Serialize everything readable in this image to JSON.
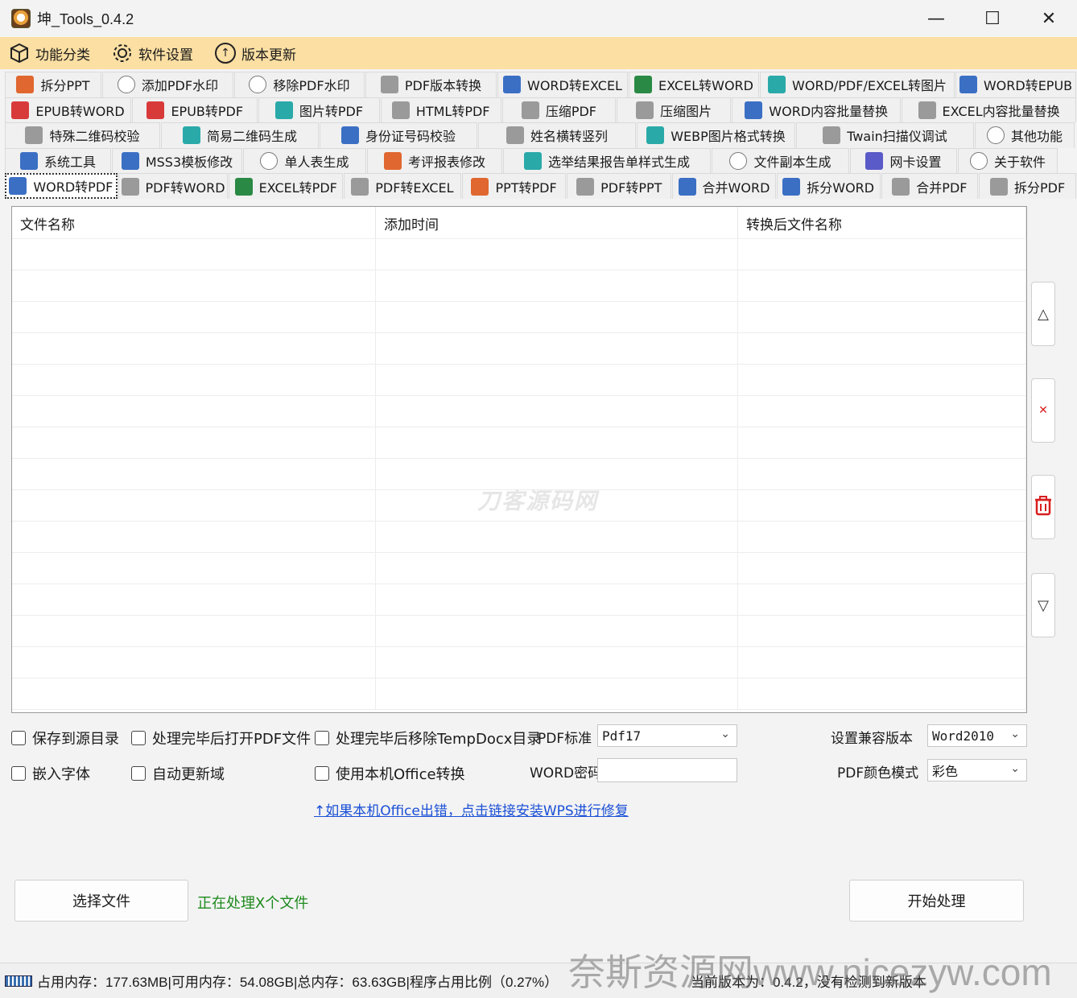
{
  "window": {
    "title": "坤_Tools_0.4.2",
    "minimize": "—",
    "maximize": "☐",
    "close": "✕"
  },
  "menu": [
    {
      "label": "功能分类",
      "icon": "cube-icon"
    },
    {
      "label": "软件设置",
      "icon": "gear-icon"
    },
    {
      "label": "版本更新",
      "icon": "upload-icon"
    }
  ],
  "tabs": [
    [
      {
        "label": "拆分PPT",
        "icon": "ppt-icon",
        "color": "orange"
      },
      {
        "label": "添加PDF水印",
        "icon": "watermark-icon",
        "color": "outline"
      },
      {
        "label": "移除PDF水印",
        "icon": "watermark-icon",
        "color": "outline"
      },
      {
        "label": "PDF版本转换",
        "icon": "pdf-icon",
        "color": "grey"
      },
      {
        "label": "WORD转EXCEL",
        "icon": "word-icon",
        "color": "blue"
      },
      {
        "label": "EXCEL转WORD",
        "icon": "excel-icon",
        "color": "green"
      },
      {
        "label": "WORD/PDF/EXCEL转图片",
        "icon": "image-icon",
        "color": "teal"
      },
      {
        "label": "WORD转EPUB",
        "icon": "word-icon",
        "color": "blue"
      }
    ],
    [
      {
        "label": "EPUB转WORD",
        "icon": "epub-icon",
        "color": "red"
      },
      {
        "label": "EPUB转PDF",
        "icon": "epub-icon",
        "color": "red"
      },
      {
        "label": "图片转PDF",
        "icon": "image-icon",
        "color": "teal"
      },
      {
        "label": "HTML转PDF",
        "icon": "pdf-icon",
        "color": "grey"
      },
      {
        "label": "压缩PDF",
        "icon": "compress-icon",
        "color": "grey"
      },
      {
        "label": "压缩图片",
        "icon": "compress-icon",
        "color": "grey"
      },
      {
        "label": "WORD内容批量替换",
        "icon": "word-icon",
        "color": "blue"
      },
      {
        "label": "EXCEL内容批量替换",
        "icon": "pdf-icon",
        "color": "grey"
      }
    ],
    [
      {
        "label": "特殊二维码校验",
        "icon": "qrcode-icon",
        "color": "grey"
      },
      {
        "label": "简易二维码生成",
        "icon": "qrcode-icon",
        "color": "teal"
      },
      {
        "label": "身份证号码校验",
        "icon": "id-card-icon",
        "color": "blue"
      },
      {
        "label": "姓名横转竖列",
        "icon": "name-icon",
        "color": "grey"
      },
      {
        "label": "WEBP图片格式转换",
        "icon": "image-icon",
        "color": "teal"
      },
      {
        "label": "Twain扫描仪调试",
        "icon": "scanner-icon",
        "color": "grey"
      },
      {
        "label": "其他功能",
        "icon": "more-icon",
        "color": "outline"
      }
    ],
    [
      {
        "label": "系统工具",
        "icon": "gear-icon",
        "color": "blue"
      },
      {
        "label": "MSS3模板修改",
        "icon": "gear-icon",
        "color": "blue"
      },
      {
        "label": "单人表生成",
        "icon": "document-icon",
        "color": "outline"
      },
      {
        "label": "考评报表修改",
        "icon": "report-icon",
        "color": "orange"
      },
      {
        "label": "选举结果报告单样式生成",
        "icon": "notebook-icon",
        "color": "teal"
      },
      {
        "label": "文件副本生成",
        "icon": "document-icon",
        "color": "outline"
      },
      {
        "label": "网卡设置",
        "icon": "network-icon",
        "color": "purple"
      },
      {
        "label": "关于软件",
        "icon": "info-icon",
        "color": "outline"
      }
    ],
    [
      {
        "label": "WORD转PDF",
        "icon": "word-icon",
        "color": "blue",
        "active": true
      },
      {
        "label": "PDF转WORD",
        "icon": "pdf-icon",
        "color": "grey"
      },
      {
        "label": "EXCEL转PDF",
        "icon": "excel-icon",
        "color": "green"
      },
      {
        "label": "PDF转EXCEL",
        "icon": "pdf-icon",
        "color": "grey"
      },
      {
        "label": "PPT转PDF",
        "icon": "ppt-icon",
        "color": "orange"
      },
      {
        "label": "PDF转PPT",
        "icon": "pdf-icon",
        "color": "grey"
      },
      {
        "label": "合并WORD",
        "icon": "word-icon",
        "color": "blue"
      },
      {
        "label": "拆分WORD",
        "icon": "word-icon",
        "color": "blue"
      },
      {
        "label": "合并PDF",
        "icon": "pdf-icon",
        "color": "grey"
      },
      {
        "label": "拆分PDF",
        "icon": "pdf-icon",
        "color": "grey"
      }
    ]
  ],
  "grid": {
    "headers": [
      "文件名称",
      "添加时间",
      "转换后文件名称"
    ],
    "watermark": "刀客源码网"
  },
  "side_buttons": {
    "up": "△",
    "delete": "✕",
    "clear": "🗑",
    "down": "▽"
  },
  "options": {
    "save_to_source": "保存到源目录",
    "open_pdf_after": "处理完毕后打开PDF文件",
    "remove_temp": "处理完毕后移除TempDocx目录",
    "pdf_standard_label": "PDF标准",
    "pdf_standard_value": "Pdf17",
    "compat_label": "设置兼容版本",
    "compat_value": "Word2010",
    "embed_fonts": "嵌入字体",
    "auto_update_fields": "自动更新域",
    "use_local_office": "使用本机Office转换",
    "word_password_label": "WORD密码",
    "pdf_color_label": "PDF颜色模式",
    "pdf_color_value": "彩色"
  },
  "link": "↑如果本机Office出错，点击链接安装WPS进行修复",
  "buttons": {
    "select_files": "选择文件",
    "start": "开始处理"
  },
  "processing": "正在处理X个文件",
  "status": {
    "memory": "占用内存：177.63MB|可用内存：54.08GB|总内存：63.63GB|程序占用比例（0.27%）",
    "version": "当前版本为：0.4.2，没有检测到新版本"
  },
  "bottom_watermark": "奈斯资源网www.nicezyw.com"
}
